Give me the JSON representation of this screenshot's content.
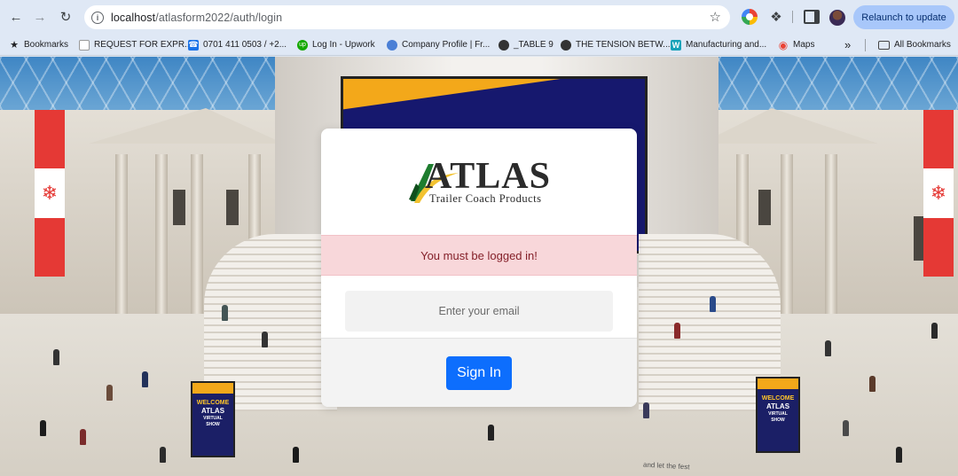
{
  "browser": {
    "url_host": "localhost",
    "url_path": "/atlasform2022/auth/login",
    "relaunch_label": "Relaunch to update",
    "icons": {
      "back": "arrow-left-icon",
      "forward": "arrow-right-icon",
      "reload": "reload-icon",
      "info": "info-icon",
      "star": "star-icon"
    }
  },
  "bookmarks_bar": {
    "items": [
      {
        "label": "Bookmarks",
        "icon": "star-icon"
      },
      {
        "label": "REQUEST FOR EXPR...",
        "icon": "document-icon"
      },
      {
        "label": "0701 411 0503 / +2...",
        "icon": "phone-icon"
      },
      {
        "label": "Log In - Upwork",
        "icon": "upwork-icon"
      },
      {
        "label": "Company Profile | Fr...",
        "icon": "company-icon"
      },
      {
        "label": "_TABLE 9",
        "icon": "globe-icon"
      },
      {
        "label": "THE TENSION BETW...",
        "icon": "globe-icon"
      },
      {
        "label": "Manufacturing and...",
        "icon": "w-icon"
      },
      {
        "label": "Maps",
        "icon": "maps-icon"
      }
    ],
    "overflow_label": "»",
    "all_bookmarks_label": "All Bookmarks"
  },
  "login": {
    "logo_word": "ATLAS",
    "logo_subtitle": "Trailer Coach Products",
    "alert_message": "You must be logged in!",
    "email_placeholder": "Enter your email",
    "email_value": "",
    "signin_label": "Sign In"
  },
  "background": {
    "kiosk_left": {
      "line1": "WELCOME",
      "line2": "ATLAS",
      "line3": "VIRTUAL",
      "line4": "SHOW"
    },
    "kiosk_right": {
      "line1": "WELCOME",
      "line2": "ATLAS",
      "line3": "VIRTUAL",
      "line4": "SHOW"
    },
    "floor_text": "and let the fest"
  },
  "colors": {
    "primary_button": "#0d6efd",
    "alert_bg": "#f8d7da",
    "alert_text": "#842029",
    "chrome_bg": "#dfe8f5",
    "relaunch_bg": "#a8c7fa"
  }
}
